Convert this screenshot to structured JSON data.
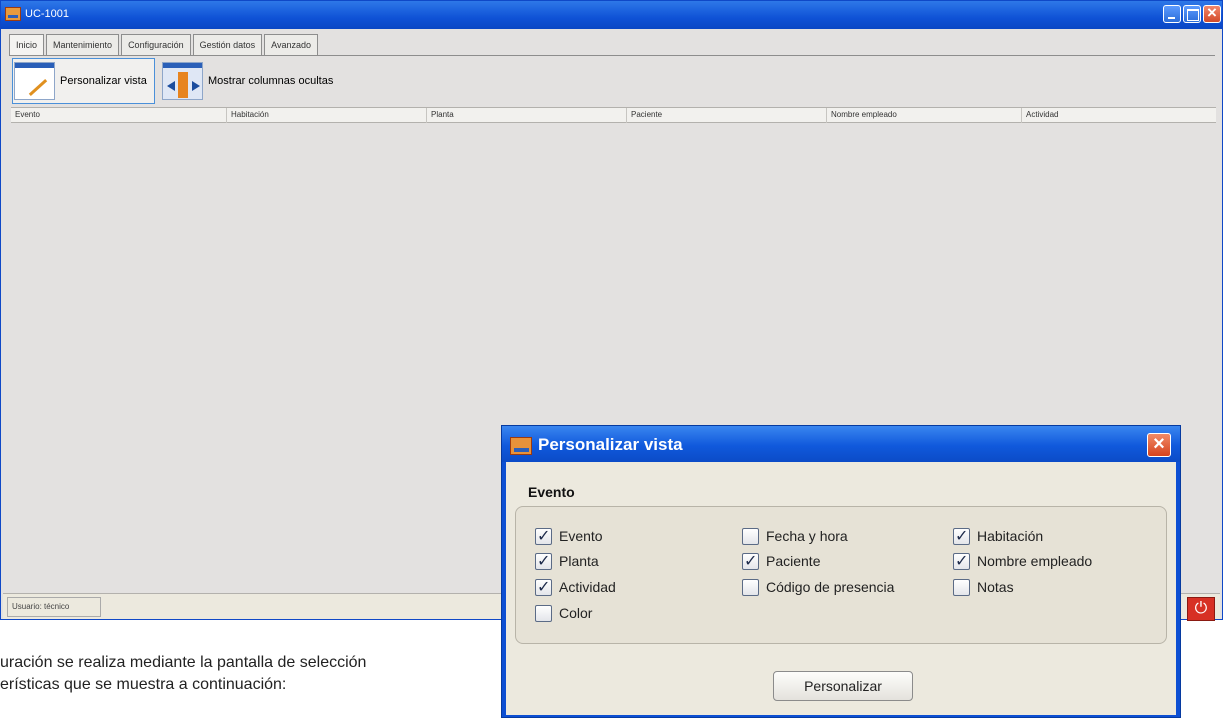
{
  "window": {
    "title": "UC-1001"
  },
  "tabs": [
    {
      "label": "Inicio"
    },
    {
      "label": "Mantenimiento"
    },
    {
      "label": "Configuración"
    },
    {
      "label": "Gestión datos"
    },
    {
      "label": "Avanzado"
    }
  ],
  "toolbar": {
    "customize_label": "Personalizar vista",
    "show_columns_label": "Mostrar columnas ocultas"
  },
  "table": {
    "columns": [
      "Evento",
      "Habitación",
      "Planta",
      "Paciente",
      "Nombre empleado",
      "Actividad"
    ]
  },
  "status": {
    "user_label": "Usuario: técnico"
  },
  "caption": {
    "line1": "uración se realiza mediante la pantalla de selección",
    "line2": "erísticas que se muestra a continuación:"
  },
  "dialog": {
    "title": "Personalizar vista",
    "group_title": "Evento",
    "options": [
      {
        "label": "Evento",
        "checked": true
      },
      {
        "label": "Fecha y hora",
        "checked": false
      },
      {
        "label": "Habitación",
        "checked": true
      },
      {
        "label": "Planta",
        "checked": true
      },
      {
        "label": "Paciente",
        "checked": true
      },
      {
        "label": "Nombre empleado",
        "checked": true
      },
      {
        "label": "Actividad",
        "checked": true
      },
      {
        "label": "Código de presencia",
        "checked": false
      },
      {
        "label": "Notas",
        "checked": false
      },
      {
        "label": "Color",
        "checked": false
      }
    ],
    "button_label": "Personalizar"
  },
  "colors": {
    "titlebar": "#0f52d6",
    "close_red": "#d24a2a",
    "window_bg": "#e3e1e0",
    "dialog_bg": "#ece9de"
  }
}
